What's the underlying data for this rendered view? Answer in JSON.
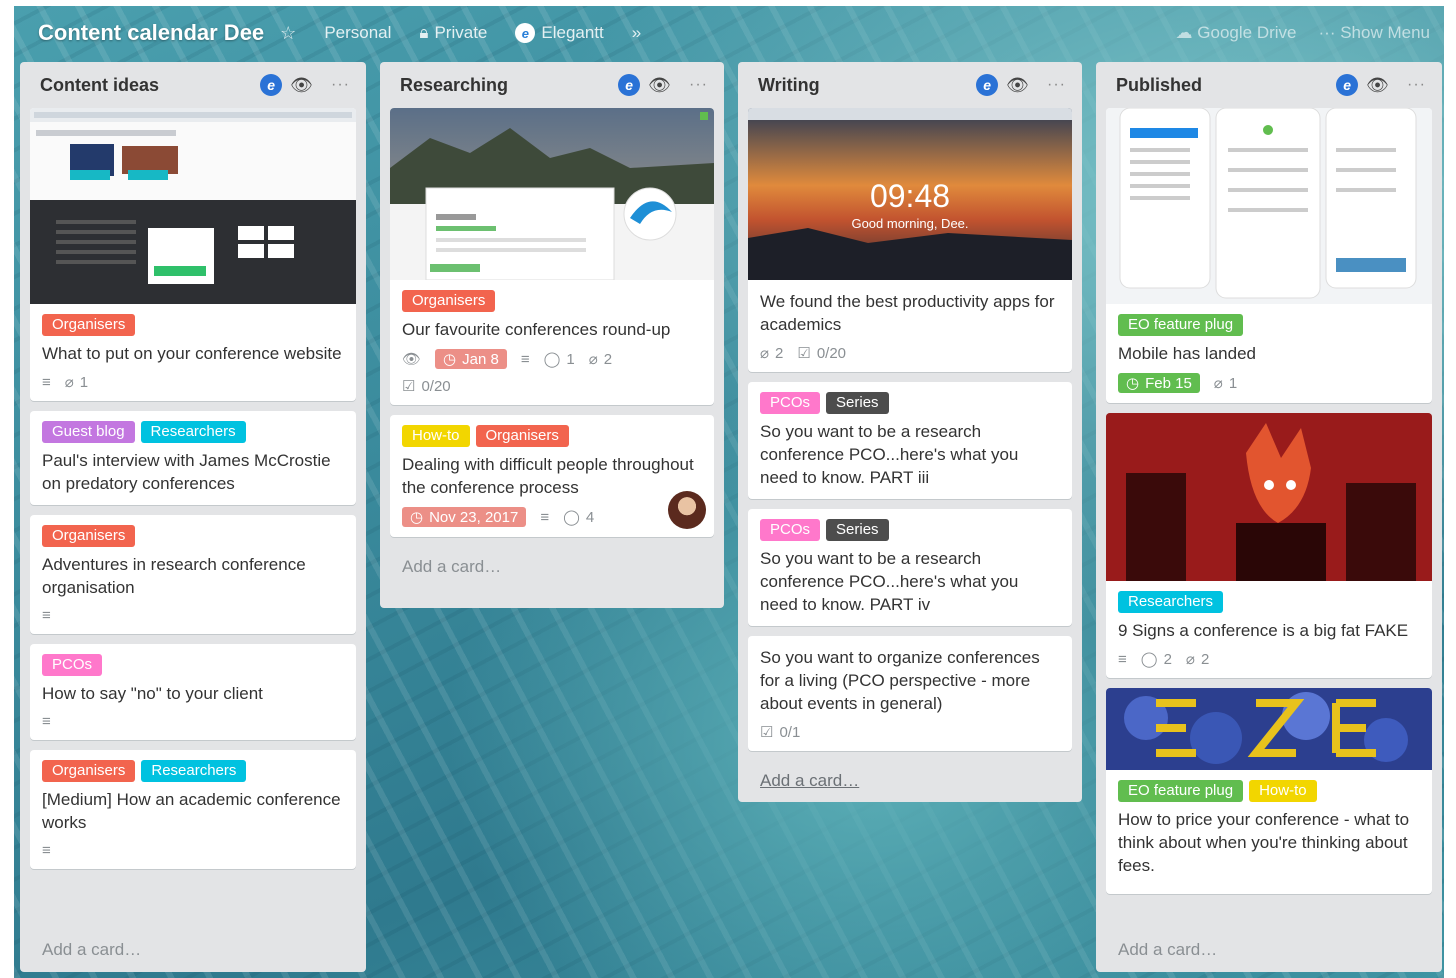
{
  "board": {
    "title": "Content calendar Dee",
    "team": "Personal",
    "visibility": "Private",
    "powerup": "Elegantt",
    "right_items": [
      "Google Drive",
      "Show Menu"
    ]
  },
  "colors": {
    "orange": "#f2644e",
    "purple": "#c377e0",
    "sky": "#00c2e0",
    "pink": "#ff78cb",
    "black": "#4d4d4d",
    "yellow": "#f2d600",
    "green": "#61bd4f",
    "due_red": "#ec8f87",
    "due_green": "#61bd4f"
  },
  "lists": [
    {
      "title": "Content ideas",
      "add_card": "Add a card…",
      "cards": [
        {
          "labels": [
            "Organisers"
          ],
          "title": "What to put on your conference website",
          "attachments": "1"
        },
        {
          "labels": [
            "Guest blog",
            "Researchers"
          ],
          "title": "Paul's interview with James McCrostie on predatory conferences"
        },
        {
          "labels": [
            "Organisers"
          ],
          "title": "Adventures in research conference organisation"
        },
        {
          "labels": [
            "PCOs"
          ],
          "title": "How to say \"no\" to your client"
        },
        {
          "labels": [
            "Organisers",
            "Researchers"
          ],
          "title": "[Medium] How an academic conference works"
        }
      ]
    },
    {
      "title": "Researching",
      "add_card": "Add a card…",
      "cards": [
        {
          "labels": [
            "Organisers"
          ],
          "title": "Our favourite conferences round-up",
          "due": "Jan 8",
          "comments": "1",
          "attachments": "2",
          "checklist": "0/20"
        },
        {
          "labels": [
            "How-to",
            "Organisers"
          ],
          "title": "Dealing with difficult people throughout the conference process",
          "due": "Nov 23, 2017",
          "comments": "4"
        }
      ]
    },
    {
      "title": "Writing",
      "add_card": "Add a card…",
      "cards": [
        {
          "title": "We found the best productivity apps for academics",
          "attachments": "2",
          "checklist": "0/20",
          "cover_time": "09:48",
          "cover_greeting": "Good morning, Dee."
        },
        {
          "labels": [
            "PCOs",
            "Series"
          ],
          "title": "So you want to be a research conference PCO...here's what you need to know. PART iii"
        },
        {
          "labels": [
            "PCOs",
            "Series"
          ],
          "title": "So you want to be a research conference PCO...here's what you need to know. PART iv"
        },
        {
          "title": "So you want to organize conferences for a living (PCO perspective - more about events in general)",
          "checklist": "0/1"
        }
      ]
    },
    {
      "title": "Published",
      "add_card": "Add a card…",
      "cards": [
        {
          "labels": [
            "EO feature plug"
          ],
          "title": "Mobile has landed",
          "due": "Feb 15",
          "attachments": "1"
        },
        {
          "labels": [
            "Researchers"
          ],
          "title": "9 Signs a conference is a big fat FAKE",
          "comments": "2",
          "attachments": "2"
        },
        {
          "labels": [
            "EO feature plug",
            "How-to"
          ],
          "title": "How to price your conference - what to think about when you're thinking about fees."
        }
      ]
    }
  ]
}
